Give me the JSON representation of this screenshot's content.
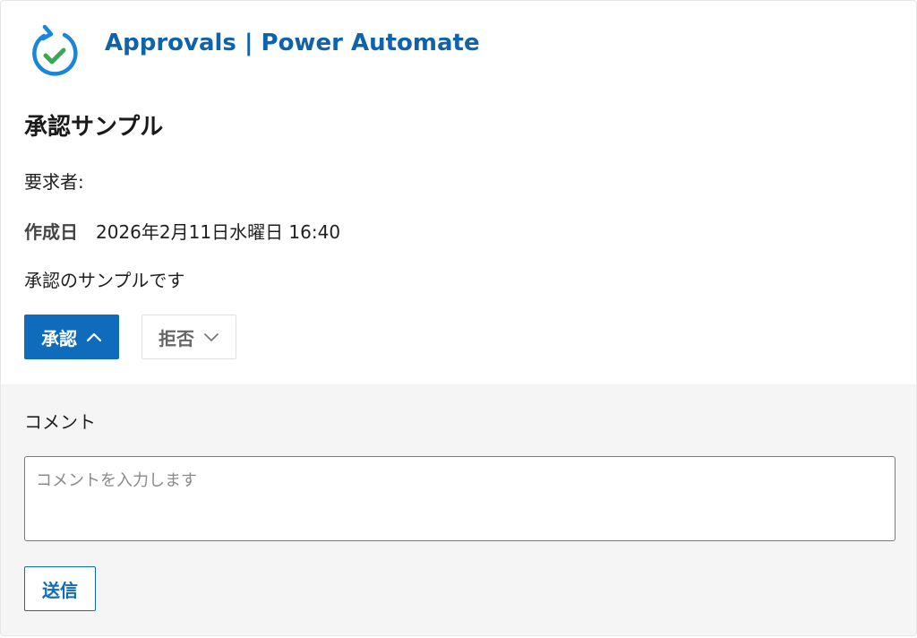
{
  "header": {
    "app_title": "Approvals | Power Automate",
    "icon": "approvals-check-icon"
  },
  "approval": {
    "title": "承認サンプル",
    "requester_label": "要求者:",
    "created_label": "作成日",
    "created_value": "2026年2月11日水曜日 16:40",
    "description": "承認のサンプルです"
  },
  "actions": {
    "approve_label": "承認",
    "reject_label": "拒否"
  },
  "comment": {
    "label": "コメント",
    "placeholder": "コメントを入力します",
    "value": "",
    "send_label": "送信"
  },
  "colors": {
    "accent": "#0f6cbd",
    "title_blue": "#0f62ac",
    "check_green": "#3aa757",
    "panel_bg": "#f5f5f5"
  }
}
